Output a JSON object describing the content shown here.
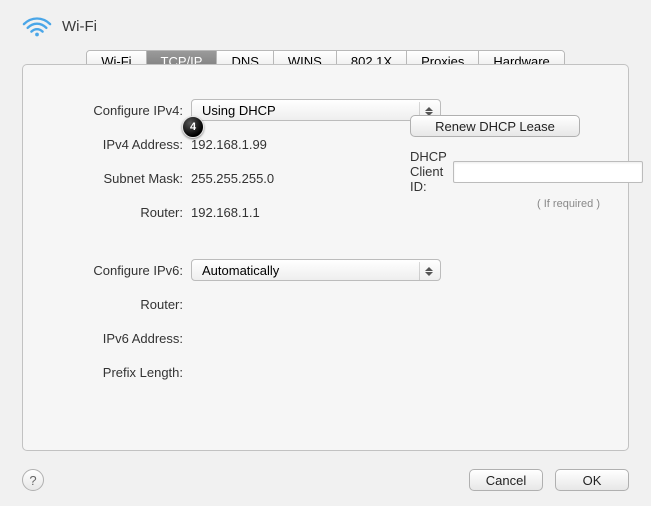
{
  "header": {
    "title": "Wi-Fi"
  },
  "tabs": {
    "items": [
      {
        "label": "Wi-Fi"
      },
      {
        "label": "TCP/IP"
      },
      {
        "label": "DNS"
      },
      {
        "label": "WINS"
      },
      {
        "label": "802.1X"
      },
      {
        "label": "Proxies"
      },
      {
        "label": "Hardware"
      }
    ],
    "active_index": 1
  },
  "ipv4": {
    "configure_label": "Configure IPv4:",
    "configure_value": "Using DHCP",
    "address_label": "IPv4 Address:",
    "address_value": "192.168.1.99",
    "subnet_label": "Subnet Mask:",
    "subnet_value": "255.255.255.0",
    "router_label": "Router:",
    "router_value": "192.168.1.1"
  },
  "dhcp": {
    "renew_button": "Renew DHCP Lease",
    "client_id_label": "DHCP Client ID:",
    "client_id_value": "",
    "hint": "( If required )"
  },
  "ipv6": {
    "configure_label": "Configure IPv6:",
    "configure_value": "Automatically",
    "router_label": "Router:",
    "router_value": "",
    "address_label": "IPv6 Address:",
    "address_value": "",
    "prefix_label": "Prefix Length:",
    "prefix_value": ""
  },
  "footer": {
    "help": "?",
    "cancel": "Cancel",
    "ok": "OK"
  },
  "annotation": {
    "step": "4"
  }
}
